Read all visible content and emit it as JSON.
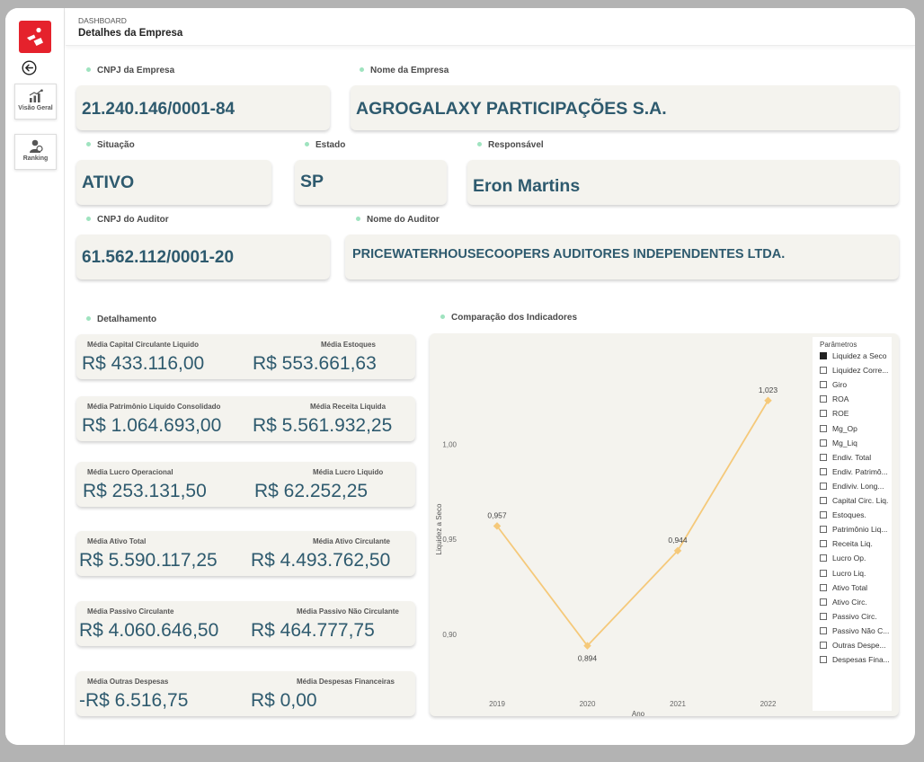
{
  "header": {
    "crumb": "DASHBOARD",
    "title": "Detalhes da Empresa"
  },
  "nav": [
    {
      "label": "Visão Geral",
      "icon": "bar-chart-icon"
    },
    {
      "label": "Ranking",
      "icon": "people-icon"
    }
  ],
  "fields": {
    "cnpj_label": "CNPJ da Empresa",
    "cnpj": "21.240.146/0001-84",
    "nome_label": "Nome da Empresa",
    "nome": "AGROGALAXY PARTICIPAÇÕES S.A.",
    "situacao_label": "Situação",
    "situacao": "ATIVO",
    "estado_label": "Estado",
    "estado": "SP",
    "resp_label": "Responsável",
    "resp": "Eron Martins",
    "cnpj_aud_label": "CNPJ do Auditor",
    "cnpj_aud": "61.562.112/0001-20",
    "nome_aud_label": "Nome do Auditor",
    "nome_aud": "PRICEWATERHOUSECOOPERS AUDITORES INDEPENDENTES LTDA."
  },
  "detalhamento": {
    "title": "Detalhamento",
    "cards": [
      {
        "l1": "Média  Capital Circulante Liquido",
        "v1": "R$ 433.116,00",
        "l2": "Média  Estoques",
        "v2": "R$ 553.661,63"
      },
      {
        "l1": "Média  Patrimônio Liquido Consolidado",
        "v1": "R$ 1.064.693,00",
        "l2": "Média  Receita Liquida",
        "v2": "R$ 5.561.932,25"
      },
      {
        "l1": "Média  Lucro Operacional",
        "v1": "R$ 253.131,50",
        "l2": "Média  Lucro Liquido",
        "v2": "R$ 62.252,25"
      },
      {
        "l1": "Média  Ativo Total",
        "v1": "R$ 5.590.117,25",
        "l2": "Média  Ativo Circulante",
        "v2": "R$ 4.493.762,50"
      },
      {
        "l1": "Média  Passivo Circulante",
        "v1": "R$ 4.060.646,50",
        "l2": "Média  Passivo Não Circulante",
        "v2": "R$ 464.777,75"
      },
      {
        "l1": "Média  Outras Despesas",
        "v1": "-R$ 6.516,75",
        "l2": "Média  Despesas Financeiras",
        "v2": "R$ 0,00"
      }
    ]
  },
  "comparacao_title": "Comparação dos Indicadores",
  "legend": {
    "title": "Parâmetros",
    "items": [
      "Liquidez a Seco",
      "Liquidez Corre...",
      "Giro",
      "ROA",
      "ROE",
      "Mg_Op",
      "Mg_Liq",
      "Endiv. Total",
      "Endiv. Patrimô...",
      "Endiviv. Long...",
      "Capital Circ. Liq.",
      "Estoques.",
      "Patrimônio Liq...",
      "Receita Liq.",
      "Lucro Op.",
      "Lucro Liq.",
      "Ativo Total",
      "Ativo Circ.",
      "Passivo Circ.",
      "Passivo Não C...",
      "Outras Despe...",
      "Despesas Fina..."
    ],
    "selected": 0
  },
  "chart_data": {
    "type": "line",
    "x": [
      "2019",
      "2020",
      "2021",
      "2022"
    ],
    "series": [
      {
        "name": "Liquidez a Seco",
        "values": [
          0.957,
          0.894,
          0.944,
          1.023
        ]
      }
    ],
    "value_labels": [
      "0,957",
      "0,894",
      "0,944",
      "1,023"
    ],
    "yticks": [
      0.9,
      0.95,
      1.0
    ],
    "ytick_labels": [
      "0,90",
      "0,95",
      "1,00"
    ],
    "ylabel": "Liquidez a Seco",
    "xlabel": "Ano",
    "color": "#f5c97a",
    "grid": false
  }
}
